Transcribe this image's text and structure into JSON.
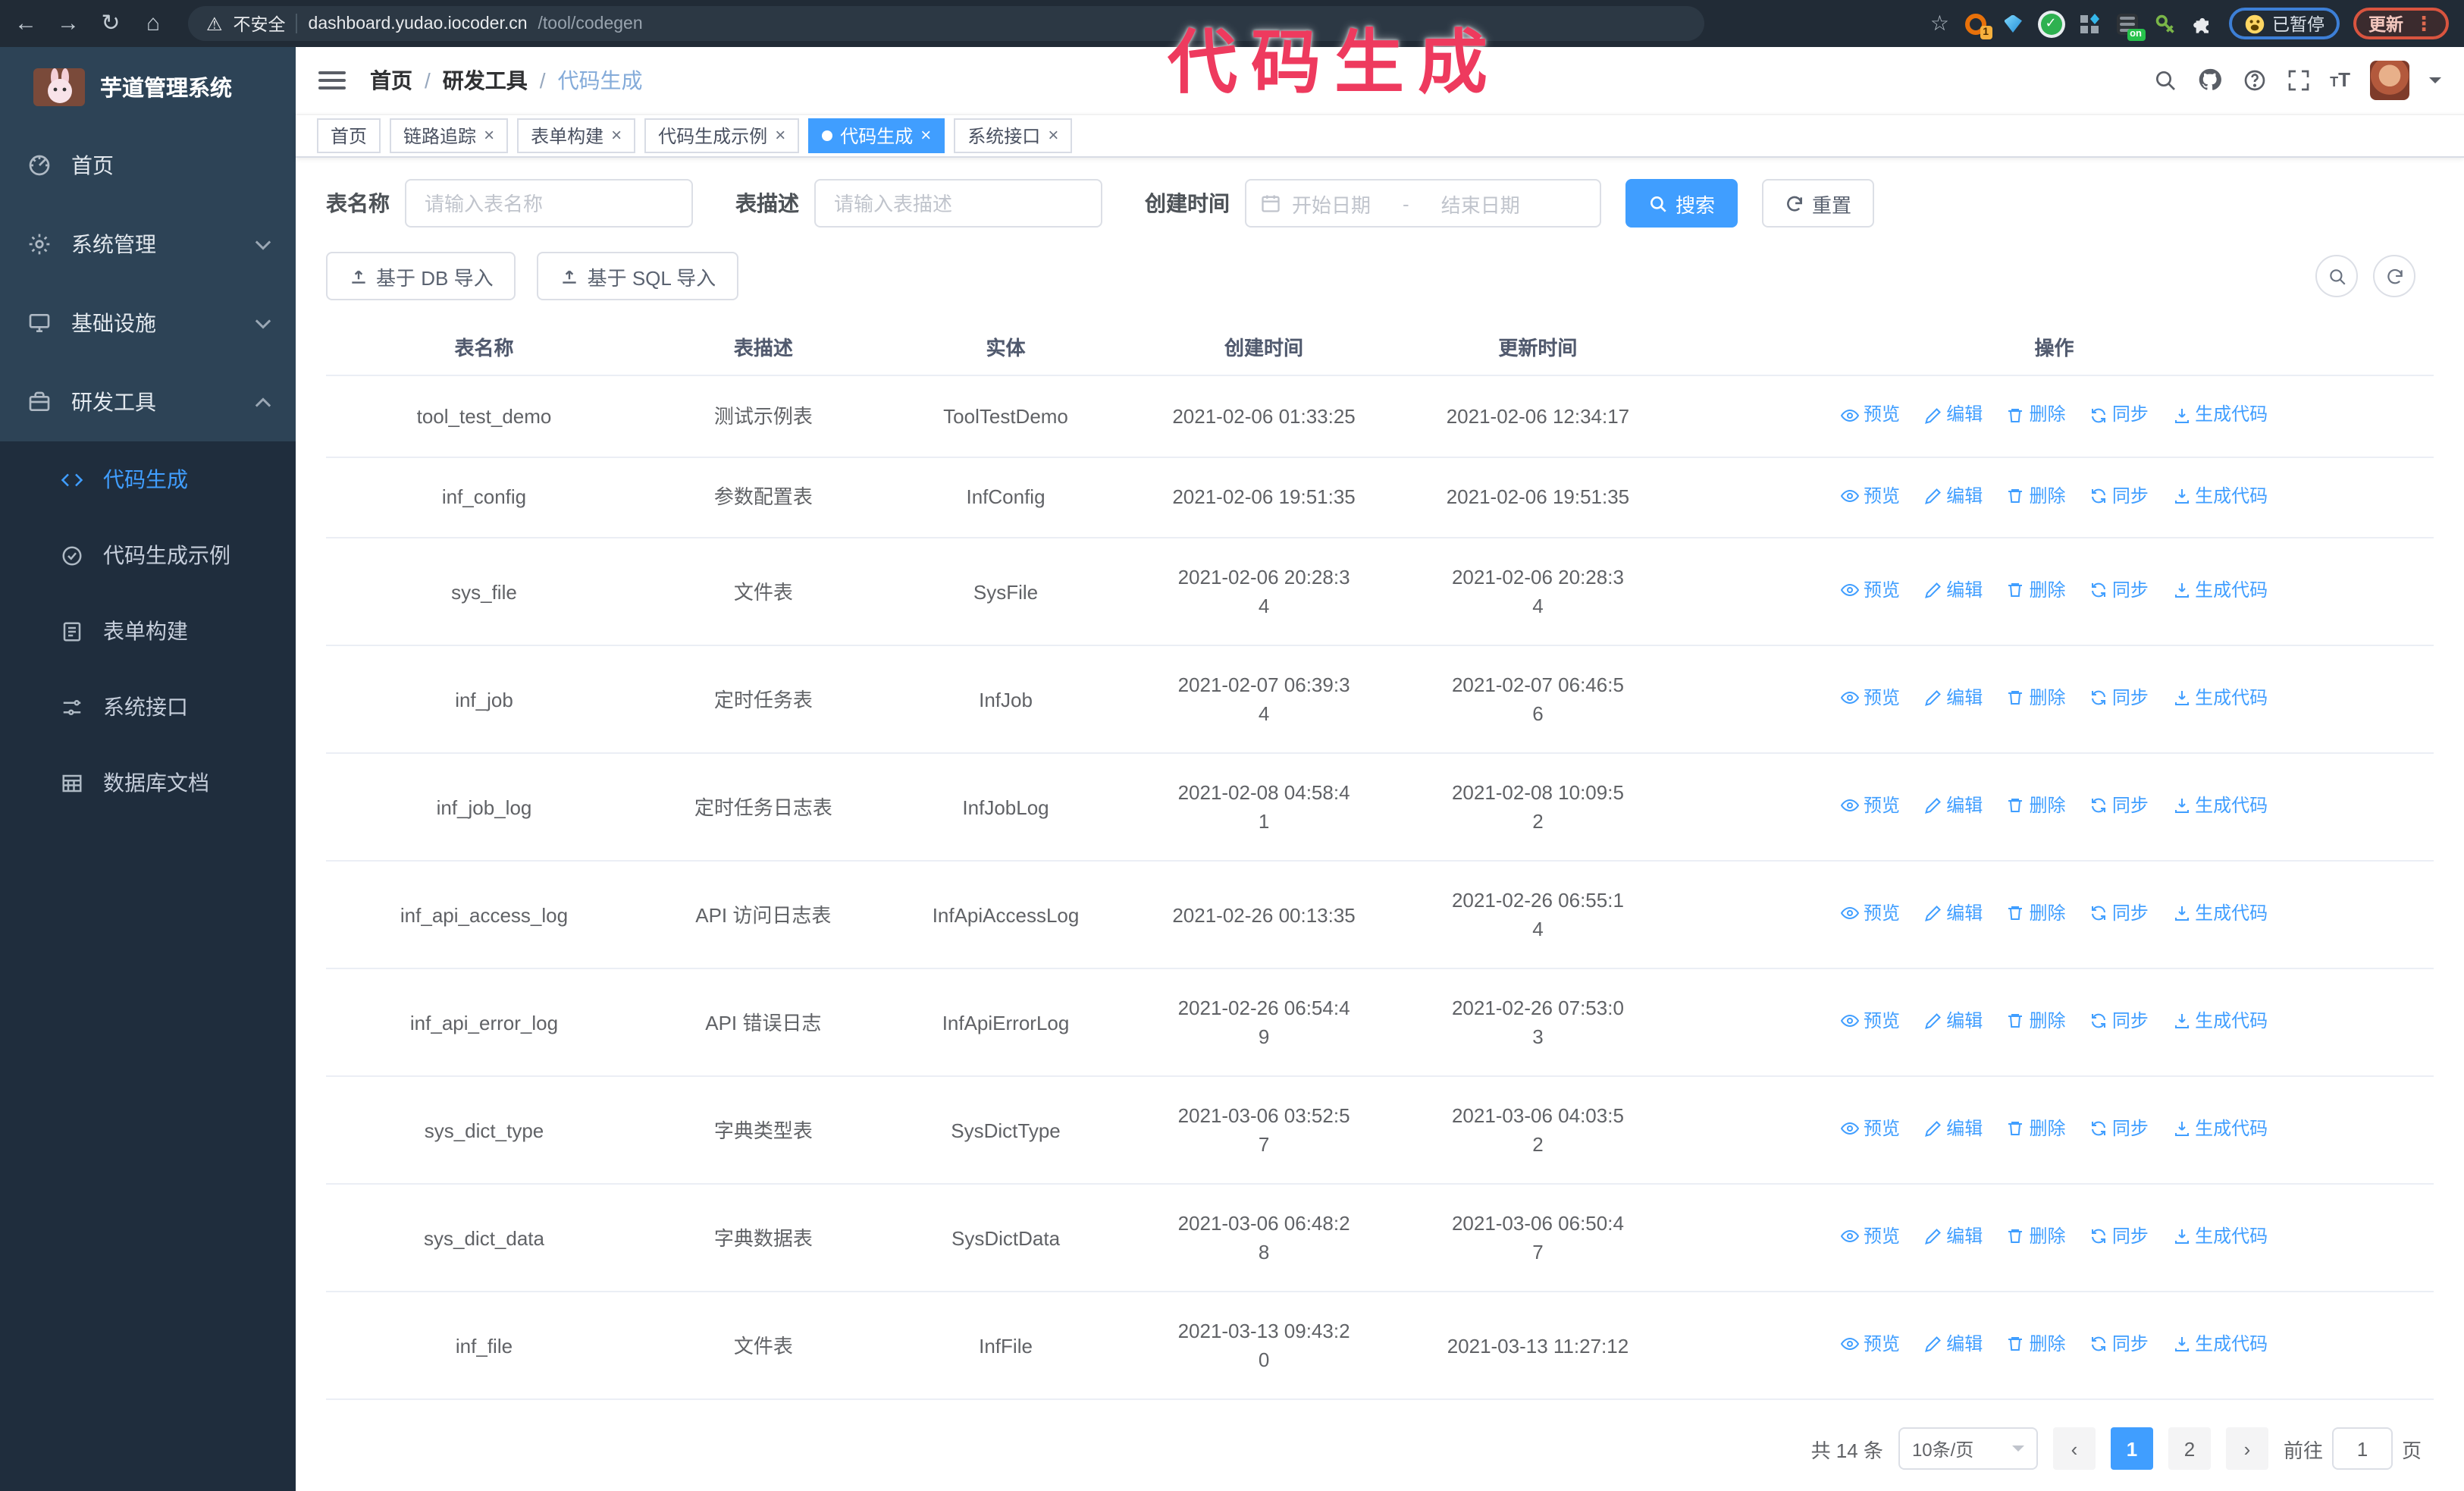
{
  "annotation": {
    "text": "代码生成"
  },
  "browser": {
    "insecure_label": "不安全",
    "url_host": "dashboard.yudao.iocoder.cn",
    "url_path": "/tool/codegen",
    "ext_badge_count": "1",
    "ext_badge_on": "on",
    "paused_badge": "已暂停",
    "update_button": "更新"
  },
  "sidebar": {
    "title": "芋道管理系统",
    "items": [
      {
        "label": "首页"
      },
      {
        "label": "系统管理"
      },
      {
        "label": "基础设施"
      },
      {
        "label": "研发工具"
      }
    ],
    "submenu": [
      {
        "label": "代码生成"
      },
      {
        "label": "代码生成示例"
      },
      {
        "label": "表单构建"
      },
      {
        "label": "系统接口"
      },
      {
        "label": "数据库文档"
      }
    ]
  },
  "breadcrumb": [
    "首页",
    "研发工具",
    "代码生成"
  ],
  "tabs": [
    {
      "label": "首页"
    },
    {
      "label": "链路追踪"
    },
    {
      "label": "表单构建"
    },
    {
      "label": "代码生成示例"
    },
    {
      "label": "代码生成"
    },
    {
      "label": "系统接口"
    }
  ],
  "filters": {
    "table_name_label": "表名称",
    "table_name_placeholder": "请输入表名称",
    "table_desc_label": "表描述",
    "table_desc_placeholder": "请输入表描述",
    "create_time_label": "创建时间",
    "date_start_placeholder": "开始日期",
    "date_separator": "-",
    "date_end_placeholder": "结束日期",
    "search_label": "搜索",
    "reset_label": "重置"
  },
  "toolbar": {
    "import_db_label": "基于 DB 导入",
    "import_sql_label": "基于 SQL 导入"
  },
  "table": {
    "columns": [
      "表名称",
      "表描述",
      "实体",
      "创建时间",
      "更新时间",
      "操作"
    ],
    "actions": [
      "预览",
      "编辑",
      "删除",
      "同步",
      "生成代码"
    ],
    "rows": [
      {
        "name": "tool_test_demo",
        "desc": "测试示例表",
        "entity": "ToolTestDemo",
        "created": "2021-02-06 01:33:25",
        "updated": "2021-02-06 12:34:17"
      },
      {
        "name": "inf_config",
        "desc": "参数配置表",
        "entity": "InfConfig",
        "created": "2021-02-06 19:51:35",
        "updated": "2021-02-06 19:51:35"
      },
      {
        "name": "sys_file",
        "desc": "文件表",
        "entity": "SysFile",
        "created": "2021-02-06 20:28:3\n4",
        "updated": "2021-02-06 20:28:3\n4"
      },
      {
        "name": "inf_job",
        "desc": "定时任务表",
        "entity": "InfJob",
        "created": "2021-02-07 06:39:3\n4",
        "updated": "2021-02-07 06:46:5\n6"
      },
      {
        "name": "inf_job_log",
        "desc": "定时任务日志表",
        "entity": "InfJobLog",
        "created": "2021-02-08 04:58:4\n1",
        "updated": "2021-02-08 10:09:5\n2"
      },
      {
        "name": "inf_api_access_log",
        "desc": "API 访问日志表",
        "entity": "InfApiAccessLog",
        "created": "2021-02-26 00:13:35",
        "updated": "2021-02-26 06:55:1\n4"
      },
      {
        "name": "inf_api_error_log",
        "desc": "API 错误日志",
        "entity": "InfApiErrorLog",
        "created": "2021-02-26 06:54:4\n9",
        "updated": "2021-02-26 07:53:0\n3"
      },
      {
        "name": "sys_dict_type",
        "desc": "字典类型表",
        "entity": "SysDictType",
        "created": "2021-03-06 03:52:5\n7",
        "updated": "2021-03-06 04:03:5\n2"
      },
      {
        "name": "sys_dict_data",
        "desc": "字典数据表",
        "entity": "SysDictData",
        "created": "2021-03-06 06:48:2\n8",
        "updated": "2021-03-06 06:50:4\n7"
      },
      {
        "name": "inf_file",
        "desc": "文件表",
        "entity": "InfFile",
        "created": "2021-03-13 09:43:2\n0",
        "updated": "2021-03-13 11:27:12"
      }
    ]
  },
  "pagination": {
    "total_label": "共 14 条",
    "page_size": "10条/页",
    "pages": [
      "1",
      "2"
    ],
    "active_page": "1",
    "goto_label": "前往",
    "goto_value": "1",
    "goto_suffix": "页"
  },
  "colors": {
    "accent": "#409eff",
    "annotation": "#ee3a5e",
    "sidebar_bg": "#2d4356",
    "submenu_bg": "#1f2d3d"
  }
}
